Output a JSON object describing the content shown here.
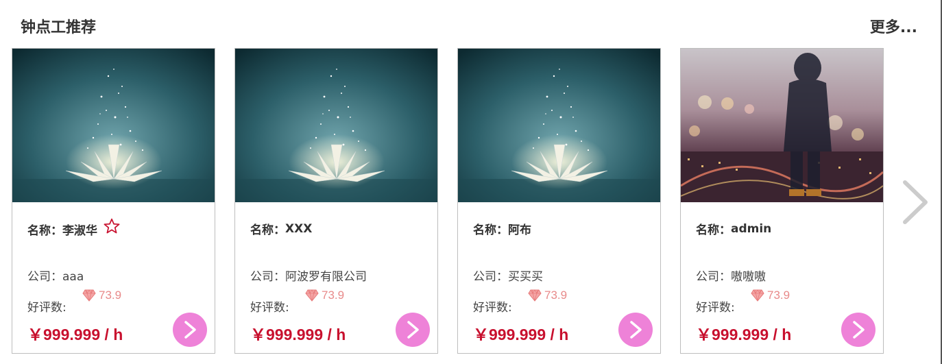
{
  "header": {
    "title": "钟点工推荐",
    "more": "更多..."
  },
  "labels": {
    "name": "名称：",
    "company": "公司：",
    "rating": "好评数:"
  },
  "cards": [
    {
      "name": "李淑华",
      "favorite": true,
      "company": "aaa",
      "rating": "73.9",
      "price": "￥999.999 / h",
      "image": "lotus"
    },
    {
      "name": "XXX",
      "favorite": false,
      "company": "阿波罗有限公司",
      "rating": "73.9",
      "price": "￥999.999 / h",
      "image": "lotus"
    },
    {
      "name": "阿布",
      "favorite": false,
      "company": "买买买",
      "rating": "73.9",
      "price": "￥999.999 / h",
      "image": "lotus"
    },
    {
      "name": "admin",
      "favorite": false,
      "company": "嗷嗷嗷",
      "rating": "73.9",
      "price": "￥999.999 / h",
      "image": "city-hooded-figure"
    }
  ],
  "colors": {
    "price": "#c8102e",
    "rating": "#e88a8a",
    "go_button": "#ee82d8",
    "star": "#c8102e"
  },
  "icons": {
    "favorite": "star-outline-icon",
    "rating": "diamond-icon",
    "go": "chevron-right-icon",
    "next": "chevron-right-icon"
  }
}
